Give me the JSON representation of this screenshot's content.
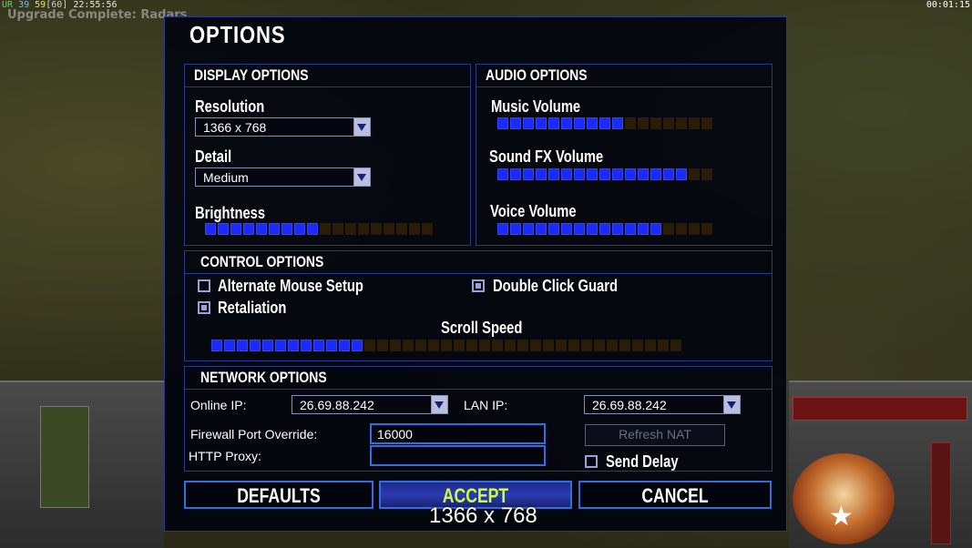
{
  "hud": {
    "ur": "UR",
    "num1": "39",
    "num2": "59",
    "num3": "[60]",
    "clock": "22:55:56",
    "timer": "00:01:15",
    "message": "Upgrade Complete: Radars"
  },
  "title": "OPTIONS",
  "display": {
    "title": "DISPLAY OPTIONS",
    "resolution_label": "Resolution",
    "resolution_value": "1366 x 768",
    "detail_label": "Detail",
    "detail_value": "Medium",
    "brightness_label": "Brightness",
    "brightness_level": {
      "on": 9,
      "total": 18
    }
  },
  "audio": {
    "title": "AUDIO OPTIONS",
    "music_label": "Music Volume",
    "music_level": {
      "on": 10,
      "total": 17
    },
    "sfx_label": "Sound FX Volume",
    "sfx_level": {
      "on": 15,
      "total": 17
    },
    "voice_label": "Voice Volume",
    "voice_level": {
      "on": 13,
      "total": 17
    }
  },
  "control": {
    "title": "CONTROL OPTIONS",
    "alt_mouse_label": "Alternate Mouse Setup",
    "alt_mouse_checked": false,
    "double_click_label": "Double Click Guard",
    "double_click_checked": true,
    "retaliation_label": "Retaliation",
    "retaliation_checked": true,
    "scroll_label": "Scroll Speed",
    "scroll_level": {
      "on": 12,
      "total": 37
    }
  },
  "network": {
    "title": "NETWORK OPTIONS",
    "online_ip_label": "Online IP:",
    "online_ip_value": "26.69.88.242",
    "lan_ip_label": "LAN IP:",
    "lan_ip_value": "26.69.88.242",
    "firewall_label": "Firewall Port Override:",
    "firewall_value": "16000",
    "proxy_label": "HTTP Proxy:",
    "proxy_value": "",
    "refresh_label": "Refresh NAT",
    "send_delay_label": "Send Delay",
    "send_delay_checked": false
  },
  "buttons": {
    "defaults": "DEFAULTS",
    "accept": "ACCEPT",
    "cancel": "CANCEL"
  },
  "tooltip": "1366 x 768"
}
